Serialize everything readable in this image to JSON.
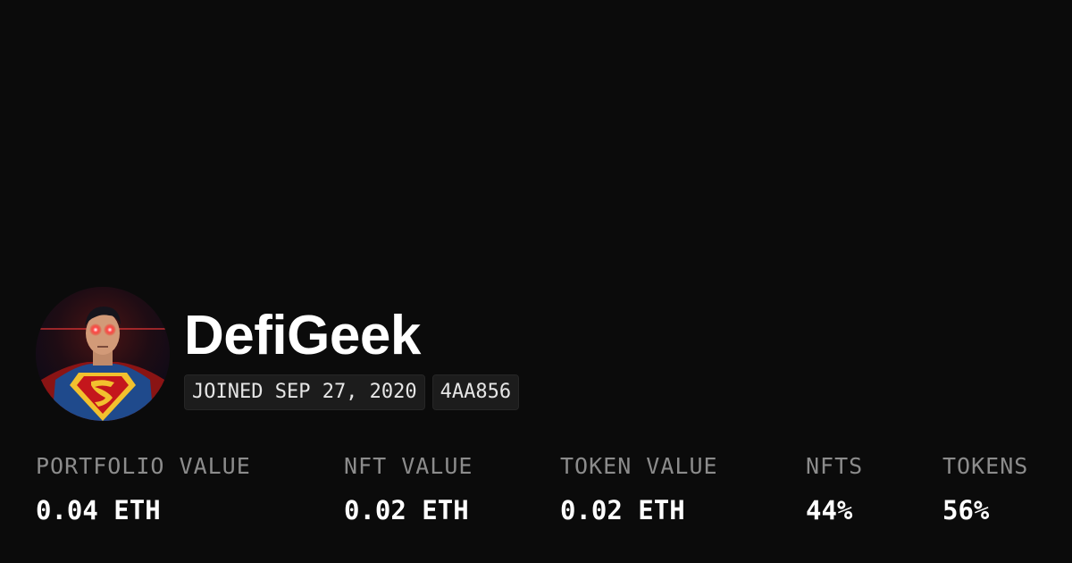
{
  "profile": {
    "username": "DefiGeek",
    "avatar_icon": "superhero-avatar",
    "joined": "JOINED SEP 27, 2020",
    "address_short": "4AA856"
  },
  "stats": [
    {
      "label": "PORTFOLIO VALUE",
      "value": "0.04 ETH"
    },
    {
      "label": "NFT VALUE",
      "value": "0.02 ETH"
    },
    {
      "label": "TOKEN VALUE",
      "value": "0.02 ETH"
    },
    {
      "label": "NFTS",
      "value": "44%"
    },
    {
      "label": "TOKENS",
      "value": "56%"
    }
  ],
  "colors": {
    "background": "#0b0b0b",
    "text_primary": "#ffffff",
    "text_muted": "#8c8c8c",
    "badge_bg": "#1c1c1c"
  }
}
